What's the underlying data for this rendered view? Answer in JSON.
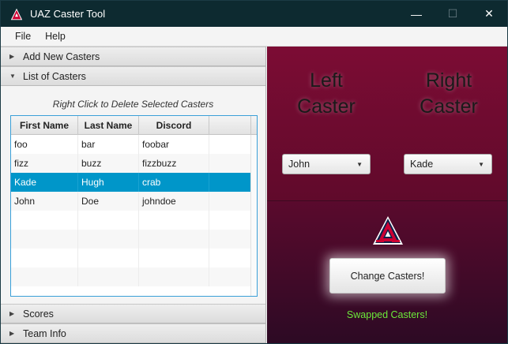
{
  "window": {
    "title": "UAZ Caster Tool",
    "minimize": "—",
    "maximize": "☐",
    "close": "✕"
  },
  "menu": {
    "file": "File",
    "help": "Help"
  },
  "accordion": {
    "add_new": "Add New Casters",
    "list": "List of Casters",
    "scores": "Scores",
    "team_info": "Team Info"
  },
  "list": {
    "hint": "Right Click to Delete Selected Casters",
    "columns": [
      "First Name",
      "Last Name",
      "Discord"
    ],
    "rows": [
      {
        "first": "foo",
        "last": "bar",
        "discord": "foobar"
      },
      {
        "first": "fizz",
        "last": "buzz",
        "discord": "fizzbuzz"
      },
      {
        "first": "Kade",
        "last": "Hugh",
        "discord": "crab"
      },
      {
        "first": "John",
        "last": "Doe",
        "discord": "johndoe"
      }
    ],
    "selected_row": 2
  },
  "casters": {
    "left_label": "Left Caster",
    "right_label": "Right Caster",
    "left_value": "John",
    "right_value": "Kade",
    "change_button": "Change Casters!",
    "status": "Swapped Casters!"
  },
  "colors": {
    "accent": "#0096c9",
    "status": "#6bea3a",
    "brand_red": "#cc0033",
    "brand_navy": "#0c234b"
  }
}
